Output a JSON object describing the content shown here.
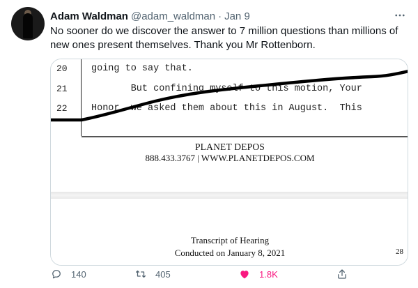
{
  "tweet": {
    "author_name": "Adam Waldman",
    "author_handle": "@adam_waldman",
    "separator": "·",
    "date": "Jan 9",
    "text": "No sooner do we discover the answer to 7 million questions than millions of new ones present themselves. Thank you Mr Rottenborn."
  },
  "media": {
    "transcript_lines": [
      {
        "num": "20",
        "text": "going to say that."
      },
      {
        "num": "21",
        "text": "       But confining myself to this motion, Your"
      },
      {
        "num": "22",
        "text": "Honor, we asked them about this in August.  This"
      }
    ],
    "footer_company": "PLANET DEPOS",
    "footer_contact": "888.433.3767 | WWW.PLANETDEPOS.COM",
    "transcript_title": "Transcript of Hearing",
    "transcript_date": "Conducted on January 8, 2021",
    "page_number": "28"
  },
  "actions": {
    "reply_count": "140",
    "retweet_count": "405",
    "like_count": "1.8K",
    "like_color": "#f91880",
    "muted_color": "#536471"
  },
  "icons": {
    "more": "more-dots-icon",
    "reply": "reply-icon",
    "retweet": "retweet-icon",
    "like": "heart-filled-icon",
    "share": "share-icon"
  }
}
